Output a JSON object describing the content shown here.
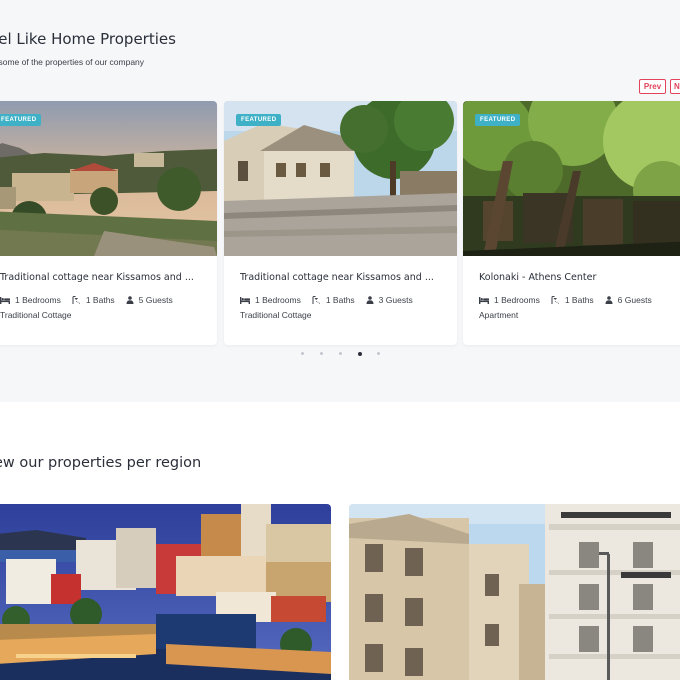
{
  "featured_section": {
    "title": "eel Like Home Properties",
    "subtitle": "w some of the properties of our company",
    "prev_label": "Prev",
    "next_label": "N"
  },
  "cards": [
    {
      "badge": "FEATURED",
      "title": "Traditional cottage near Kissamos and ...",
      "bedrooms": "1 Bedrooms",
      "baths": "1 Baths",
      "guests": "5 Guests",
      "type": "Traditional Cottage"
    },
    {
      "badge": "FEATURED",
      "title": "Traditional cottage near Kissamos and ...",
      "bedrooms": "1 Bedrooms",
      "baths": "1 Baths",
      "guests": "3 Guests",
      "type": "Traditional Cottage"
    },
    {
      "badge": "FEATURED",
      "title": "Kolonaki - Athens Center",
      "bedrooms": "1 Bedrooms",
      "baths": "1 Baths",
      "guests": "6 Guests",
      "type": "Apartment"
    }
  ],
  "carousel": {
    "dot_count": 5,
    "active_index": 3
  },
  "region_section": {
    "title": "ew our properties per region"
  },
  "colors": {
    "accent": "#e2445c",
    "badge": "#3fb1c6",
    "section_bg": "#f6f7f9"
  },
  "icons": [
    "bed-icon",
    "bath-icon",
    "user-icon"
  ]
}
